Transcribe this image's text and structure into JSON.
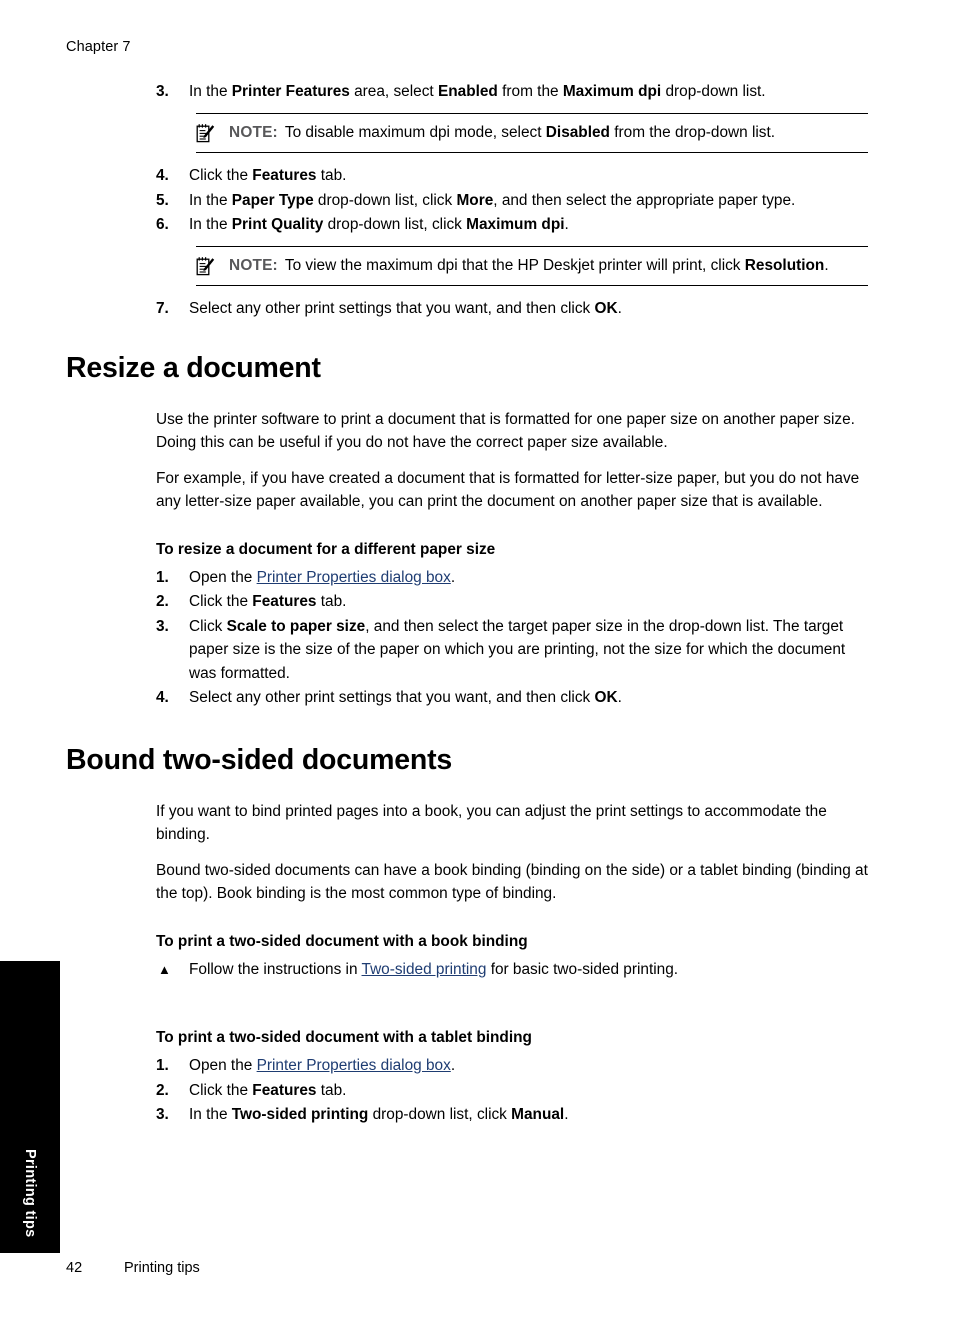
{
  "page": {
    "chapter_label": "Chapter 7",
    "footer_page_number": "42",
    "footer_section": "Printing tips",
    "thumb_tab_label": "Printing tips",
    "link_color": "#1e3c72",
    "note_label_color": "#58585a"
  },
  "max_dpi_steps": {
    "step3": {
      "num": "3.",
      "t1": "In the ",
      "b1": "Printer Features",
      "t2": " area, select ",
      "b2": "Enabled",
      "t3": " from the ",
      "b3": "Maximum dpi",
      "t4": " drop-down list."
    },
    "note1": {
      "label": "NOTE:",
      "t1": "To disable maximum dpi mode, select ",
      "b1": "Disabled",
      "t2": " from the drop-down list."
    },
    "step4": {
      "num": "4.",
      "t1": "Click the ",
      "b1": "Features",
      "t2": " tab."
    },
    "step5": {
      "num": "5.",
      "t1": "In the ",
      "b1": "Paper Type",
      "t2": " drop-down list, click ",
      "b2": "More",
      "t3": ", and then select the appropriate paper type."
    },
    "step6": {
      "num": "6.",
      "t1": "In the ",
      "b1": "Print Quality",
      "t2": " drop-down list, click ",
      "b2": "Maximum dpi",
      "t3": "."
    },
    "note2": {
      "label": "NOTE:",
      "t1": "To view the maximum dpi that the HP Deskjet printer will print, click ",
      "b1": "Resolution",
      "t2": "."
    },
    "step7": {
      "num": "7.",
      "t1": "Select any other print settings that you want, and then click ",
      "b1": "OK",
      "t2": "."
    }
  },
  "resize_section": {
    "heading": "Resize a document",
    "para1": "Use the printer software to print a document that is formatted for one paper size on another paper size. Doing this can be useful if you do not have the correct paper size available.",
    "para2": "For example, if you have created a document that is formatted for letter-size paper, but you do not have any letter-size paper available, you can print the document on another paper size that is available.",
    "subheading": "To resize a document for a different paper size",
    "step1": {
      "num": "1.",
      "t1": "Open the ",
      "link": "Printer Properties dialog box",
      "t2": "."
    },
    "step2": {
      "num": "2.",
      "t1": "Click the ",
      "b1": "Features",
      "t2": " tab."
    },
    "step3": {
      "num": "3.",
      "t1": "Click ",
      "b1": "Scale to paper size",
      "t2": ", and then select the target paper size in the drop-down list. The target paper size is the size of the paper on which you are printing, not the size for which the document was formatted."
    },
    "step4": {
      "num": "4.",
      "t1": "Select any other print settings that you want, and then click ",
      "b1": "OK",
      "t2": "."
    }
  },
  "bound_section": {
    "heading": "Bound two-sided documents",
    "para1": "If you want to bind printed pages into a book, you can adjust the print settings to accommodate the binding.",
    "para2": "Bound two-sided documents can have a book binding (binding on the side) or a tablet binding (binding at the top). Book binding is the most common type of binding.",
    "book_subheading": "To print a two-sided document with a book binding",
    "book_step": {
      "bullet": "▲",
      "t1": "Follow the instructions in ",
      "link": "Two-sided printing",
      "t2": " for basic two-sided printing."
    },
    "tablet_subheading": "To print a two-sided document with a tablet binding",
    "tablet_step1": {
      "num": "1.",
      "t1": "Open the ",
      "link": "Printer Properties dialog box",
      "t2": "."
    },
    "tablet_step2": {
      "num": "2.",
      "t1": "Click the ",
      "b1": "Features",
      "t2": " tab."
    },
    "tablet_step3": {
      "num": "3.",
      "t1": "In the ",
      "b1": "Two-sided printing",
      "t2": " drop-down list, click ",
      "b2": "Manual",
      "t3": "."
    }
  }
}
